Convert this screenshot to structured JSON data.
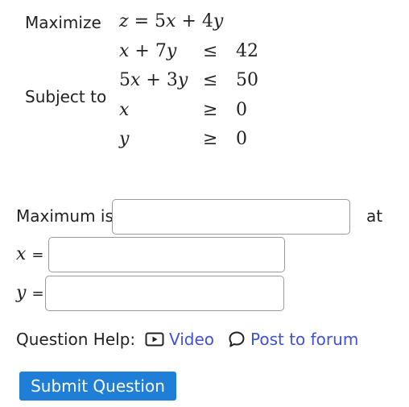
{
  "problem": {
    "maximize_label": "Maximize",
    "subject_to_label": "Subject to",
    "objective": {
      "lhs": "z",
      "eq": "=",
      "coef1": "5",
      "var1": "x",
      "op": "+",
      "coef2": "4",
      "var2": "y"
    },
    "constraints": [
      {
        "lhs_a": "x",
        "op": "+",
        "coef": "7",
        "var": "y",
        "rel": "≤",
        "rhs": "42"
      },
      {
        "lhs_c": "5",
        "lhs_a": "x",
        "op": "+",
        "coef": "3",
        "var": "y",
        "rel": "≤",
        "rhs": "50"
      },
      {
        "lhs_a": "x",
        "rel": "≥",
        "rhs": "0"
      },
      {
        "lhs_a": "y",
        "rel": "≥",
        "rhs": "0"
      }
    ]
  },
  "answer": {
    "maximum_label": "Maximum is",
    "at_label": "at",
    "x_var": "x",
    "y_var": "y",
    "eq": "=",
    "maximum_value": "",
    "x_value": "",
    "y_value": ""
  },
  "help": {
    "label": "Question Help:",
    "video_label": "Video",
    "forum_label": "Post to forum"
  },
  "submit": {
    "label": "Submit Question"
  },
  "colors": {
    "link": "#3f51d9",
    "submit_bg": "#1f7fd6"
  }
}
